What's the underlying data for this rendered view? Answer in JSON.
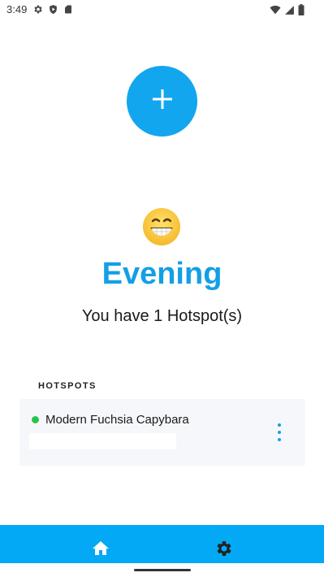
{
  "status_bar": {
    "time": "3:49",
    "left_icons": [
      "gear-icon",
      "shield-icon",
      "sim-card-icon"
    ],
    "right_icons": [
      "wifi-icon",
      "cell-signal-icon",
      "battery-icon"
    ]
  },
  "fab": {
    "icon": "plus-icon",
    "color": "#12a6ee"
  },
  "greeting": {
    "emoji": "grinning-face-emoji",
    "title": "Evening",
    "subtitle": "You have 1 Hotspot(s)"
  },
  "hotspots": {
    "section_label": "HOTSPOTS",
    "items": [
      {
        "name": "Modern Fuchsia Capybara",
        "status_color": "#29c34a",
        "menu_icon": "more-vertical-icon"
      }
    ]
  },
  "bottom_nav": {
    "background": "#03a9f4",
    "items": [
      {
        "icon": "home-icon"
      },
      {
        "icon": "settings-gear-icon"
      }
    ]
  }
}
